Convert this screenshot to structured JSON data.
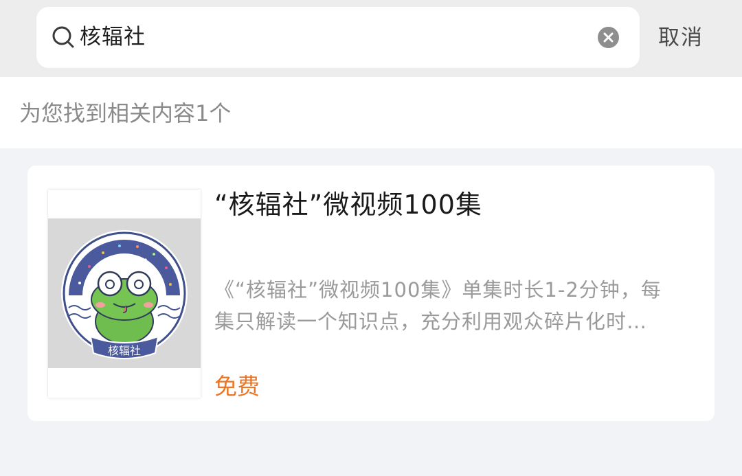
{
  "search": {
    "query": "核辐社",
    "cancel_label": "取消"
  },
  "results": {
    "count_text": "为您找到相关内容1个",
    "items": [
      {
        "title": "“核辐社”微视频100集",
        "desc_line1": "《“核辐社”微视频100集》单集时长1-2分钟，每",
        "desc_line2": "集只解读一个知识点，充分利用观众碎片化时…",
        "price": "免费",
        "thumbnail_logo_text": "核辐社"
      }
    ]
  },
  "colors": {
    "price": "#ec7626",
    "background": "#f2f3f6"
  }
}
